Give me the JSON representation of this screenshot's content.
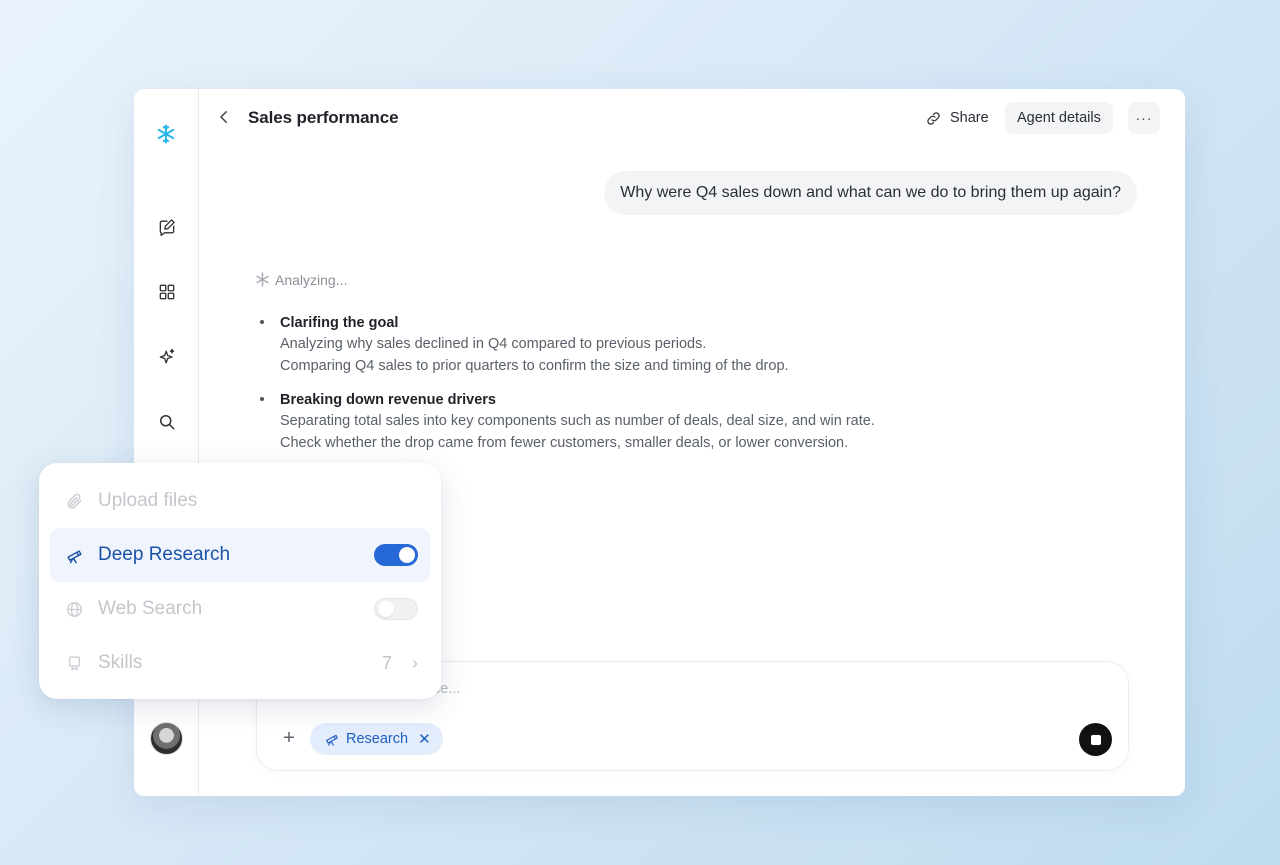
{
  "header": {
    "title": "Sales performance",
    "share_label": "Share",
    "agent_details_label": "Agent details",
    "more_label": "···"
  },
  "chat": {
    "user_message": "Why were Q4 sales down and what can we do to bring them up again?",
    "status": "Analyzing...",
    "steps": [
      {
        "title": "Clarifing the goal",
        "lines": [
          "Analyzing why sales declined in Q4 compared to previous periods.",
          "Comparing Q4 sales to prior quarters to confirm the size and timing of the drop."
        ]
      },
      {
        "title": "Breaking down revenue drivers",
        "lines": [
          "Separating total sales into key components such as number of deals, deal size, and win rate.",
          "Check whether the drop came from fewer customers, smaller deals, or lower conversion."
        ]
      }
    ]
  },
  "composer": {
    "placeholder_fragment": "ce...",
    "plus_label": "+",
    "chip_label": "Research",
    "chip_close": "✕"
  },
  "tools_menu": {
    "upload_label": "Upload files",
    "deep_research_label": "Deep Research",
    "deep_research_enabled": true,
    "web_search_label": "Web Search",
    "web_search_enabled": false,
    "skills_label": "Skills",
    "skills_count": "7"
  },
  "colors": {
    "accent": "#2568d6",
    "active_text": "#1a52a8",
    "chip_bg": "#e3edfc",
    "logo": "#29b5e8"
  }
}
